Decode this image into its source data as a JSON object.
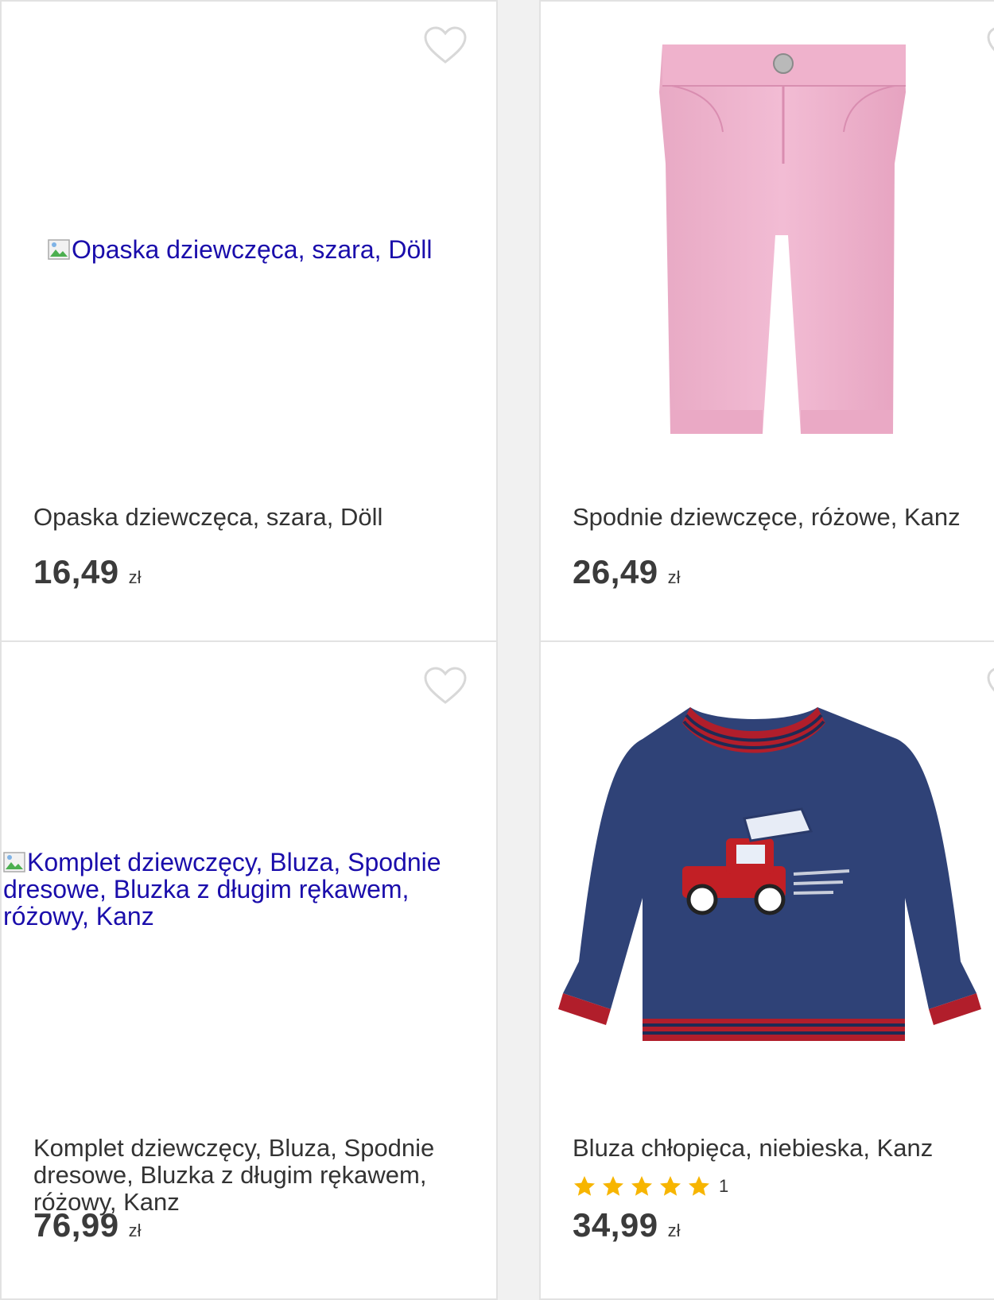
{
  "products": [
    {
      "name": "Opaska dziewczęca, szara, Döll",
      "image_alt": "Opaska dziewczęca, szara, Döll",
      "price": "16,49",
      "currency": "zł"
    },
    {
      "name": "Spodnie dziewczęce, różowe, Kanz",
      "price": "26,49",
      "currency": "zł"
    },
    {
      "name": "Komplet dziewczęcy, Bluza, Spodnie dresowe, Bluzka z długim rękawem, różowy, Kanz",
      "image_alt": "Komplet dziewczęcy, Bluza, Spodnie dresowe, Bluzka z długim rękawem, różowy, Kanz",
      "price": "76,99",
      "currency": "zł"
    },
    {
      "name": "Bluza chłopięca, niebieska, Kanz",
      "rating_stars": 5,
      "rating_count": "1",
      "price": "34,99",
      "currency": "zł"
    }
  ],
  "icons": {
    "favorite": "heart-outline-icon",
    "rating": "star-icon",
    "broken_image": "broken-image-icon"
  },
  "colors": {
    "star": "#f7b500",
    "link": "#1a0dab",
    "heart_outline": "#d8d8d8"
  }
}
